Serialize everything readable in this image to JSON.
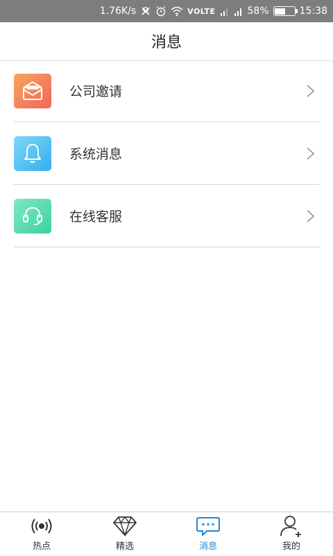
{
  "status_bar": {
    "speed": "1.76K/s",
    "network": "VOLTE",
    "battery": "58%",
    "battery_level": 0.58,
    "time": "15:38"
  },
  "header": {
    "title": "消息"
  },
  "menu": [
    {
      "label": "公司邀请",
      "icon": "envelope-icon",
      "colors": [
        "#f8a45b",
        "#f0665d"
      ]
    },
    {
      "label": "系统消息",
      "icon": "bell-icon",
      "colors": [
        "#7fd9f5",
        "#33aef0"
      ]
    },
    {
      "label": "在线客服",
      "icon": "headset-icon",
      "colors": [
        "#7fe8c1",
        "#3fcfa4"
      ]
    }
  ],
  "tabs": [
    {
      "label": "热点",
      "icon": "broadcast-icon",
      "active": false
    },
    {
      "label": "精选",
      "icon": "diamond-icon",
      "active": false
    },
    {
      "label": "消息",
      "icon": "chat-icon",
      "active": true
    },
    {
      "label": "我的",
      "icon": "user-add-icon",
      "active": false
    }
  ],
  "colors": {
    "accent": "#1f86d6",
    "status_bar": "#7d7d7d",
    "divider": "#d8d8d8"
  }
}
